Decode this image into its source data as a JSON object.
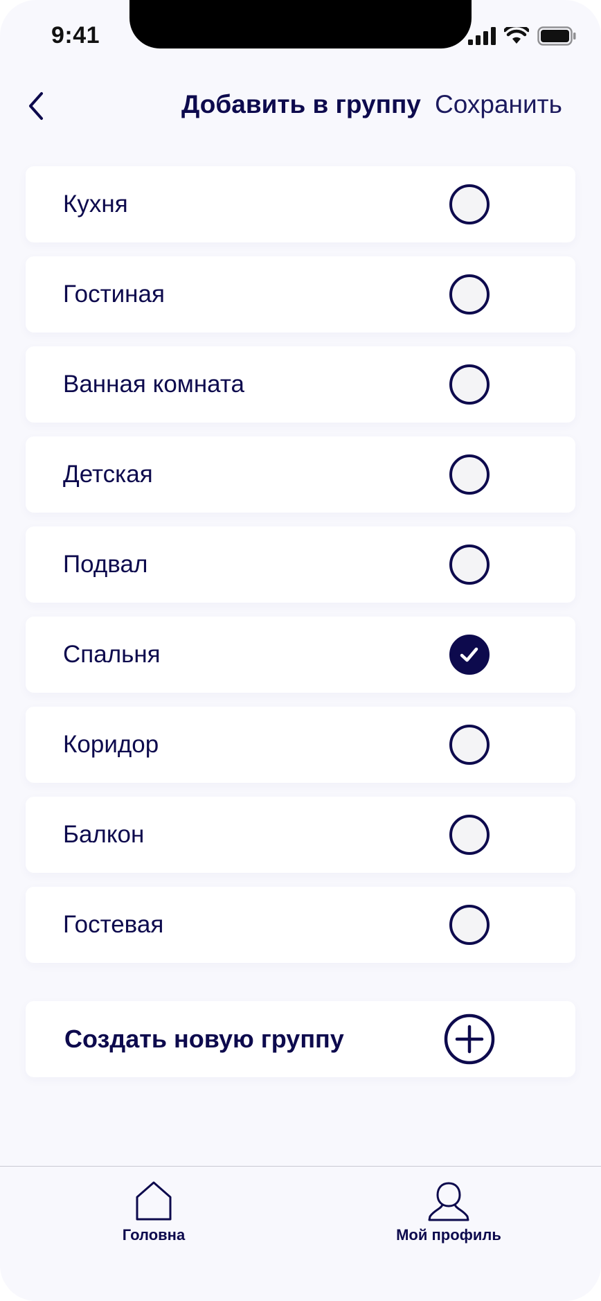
{
  "status_bar": {
    "time": "9:41"
  },
  "header": {
    "title": "Добавить в группу",
    "save_label": "Сохранить"
  },
  "groups": [
    {
      "label": "Кухня",
      "selected": false
    },
    {
      "label": "Гостиная",
      "selected": false
    },
    {
      "label": "Ванная комната",
      "selected": false
    },
    {
      "label": "Детская",
      "selected": false
    },
    {
      "label": "Подвал",
      "selected": false
    },
    {
      "label": "Спальня",
      "selected": true
    },
    {
      "label": "Коридор",
      "selected": false
    },
    {
      "label": "Балкон",
      "selected": false
    },
    {
      "label": "Гостевая",
      "selected": false
    }
  ],
  "create_group": {
    "label": "Создать новую группу",
    "icon": "plus-circle-icon"
  },
  "tab_bar": {
    "home": {
      "label": "Головна",
      "icon": "home-icon"
    },
    "profile": {
      "label": "Мой профиль",
      "icon": "user-icon"
    }
  },
  "colors": {
    "primary": "#0d0a4d",
    "background": "#f8f8fd",
    "card": "#ffffff"
  }
}
